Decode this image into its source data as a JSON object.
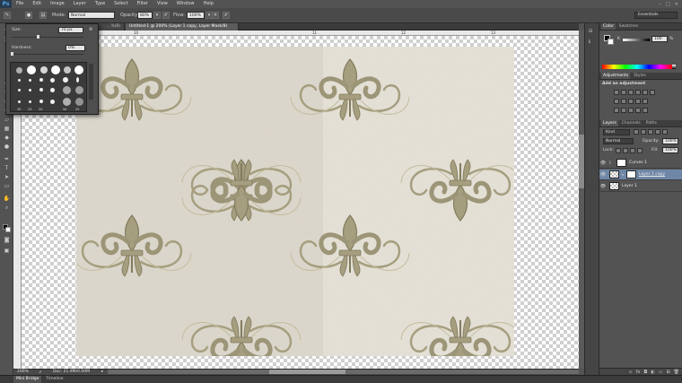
{
  "app": {
    "logo": "Ps"
  },
  "menu": [
    "File",
    "Edit",
    "Image",
    "Layer",
    "Type",
    "Select",
    "Filter",
    "View",
    "Window",
    "Help"
  ],
  "options_bar": {
    "mode_label": "Mode:",
    "mode_value": "Normal",
    "opacity_label": "Opacity:",
    "opacity_value": "80%",
    "flow_label": "Flow:",
    "flow_value": "100%",
    "workspace": "Essentials"
  },
  "brush_popup": {
    "size_label": "Size:",
    "size_value": "70 px",
    "hardness_label": "Hardness:",
    "hardness_value": "0%",
    "tip_numbers": [
      "30",
      "25",
      "20",
      "50",
      "25"
    ]
  },
  "document": {
    "tabs": [
      "...%/8)",
      "Untitled-1 @ 200% (Layer 1 copy, Layer Mask/8)"
    ],
    "ruler_marks": [
      "10",
      "11",
      "12",
      "13"
    ],
    "zoom": "200%",
    "doc_info": "Doc: 21.9M/0.00M"
  },
  "bottom_tabs": [
    "Mini Bridge",
    "Timeline"
  ],
  "color_panel": {
    "tabs": [
      "Color",
      "Swatches"
    ],
    "slider_label": "K",
    "slider_value": "100",
    "slider_unit": "%"
  },
  "adjustments_panel": {
    "tabs": [
      "Adjustments",
      "Styles"
    ],
    "title": "Add an adjustment"
  },
  "layers_panel": {
    "tabs": [
      "Layers",
      "Channels",
      "Paths"
    ],
    "kind": "Kind",
    "blend_mode": "Normal",
    "opacity_label": "Opacity:",
    "opacity_value": "100%",
    "lock_label": "Lock:",
    "fill_label": "Fill:",
    "fill_value": "100%",
    "layers": [
      {
        "name": "Curves 1",
        "selected": false
      },
      {
        "name": "Layer 1 copy",
        "selected": true
      },
      {
        "name": "Layer 1",
        "selected": false
      }
    ]
  },
  "colors": {
    "accent": "#6f87a6",
    "pattern_base": "#ddd8cc",
    "pattern_motif": "#a49c7a",
    "ps_blue": "#4fa8e8"
  },
  "icons": [
    "brush-icon",
    "move-icon",
    "marquee-icon",
    "lasso-icon",
    "quick-select-icon",
    "crop-icon",
    "eyedropper-icon",
    "healing-icon",
    "clone-icon",
    "history-brush-icon",
    "eraser-icon",
    "gradient-icon",
    "blur-icon",
    "dodge-icon",
    "pen-icon",
    "type-icon",
    "path-select-icon",
    "shape-icon",
    "hand-icon",
    "zoom-icon",
    "eye-icon",
    "chain-icon"
  ]
}
